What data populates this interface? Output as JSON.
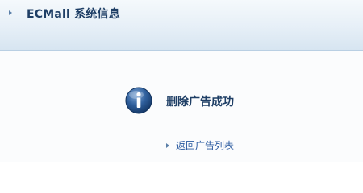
{
  "header": {
    "title": "ECMall 系统信息"
  },
  "message": {
    "icon": "info-icon",
    "text": "删除广告成功"
  },
  "links": [
    {
      "label": "返回广告列表"
    }
  ],
  "colors": {
    "title_text": "#1f3f66",
    "link_text": "#2a5aa0",
    "header_gradient_bottom": "#d7e5f1"
  }
}
